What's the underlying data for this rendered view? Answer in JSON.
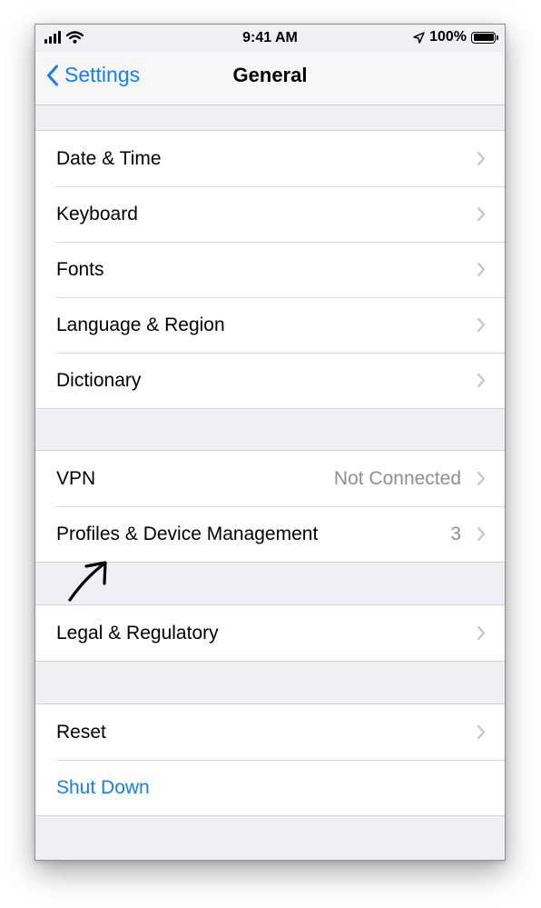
{
  "status": {
    "time": "9:41 AM",
    "battery": "100%"
  },
  "nav": {
    "back_label": "Settings",
    "title": "General"
  },
  "groups": [
    {
      "items": [
        {
          "label": "Date & Time"
        },
        {
          "label": "Keyboard"
        },
        {
          "label": "Fonts"
        },
        {
          "label": "Language & Region"
        },
        {
          "label": "Dictionary"
        }
      ]
    },
    {
      "items": [
        {
          "label": "VPN",
          "detail": "Not Connected"
        },
        {
          "label": "Profiles & Device Management",
          "detail": "3"
        }
      ]
    },
    {
      "items": [
        {
          "label": "Legal & Regulatory"
        }
      ]
    },
    {
      "items": [
        {
          "label": "Reset"
        },
        {
          "label": "Shut Down"
        }
      ]
    }
  ],
  "colors": {
    "accent": "#147efb",
    "background": "#efeff4",
    "annotation": "#000000"
  },
  "icons": [
    "cellular-signal-icon",
    "wifi-icon",
    "location-arrow-icon",
    "battery-icon",
    "chevron-left-icon",
    "chevron-right-icon",
    "annotation-arrow-icon"
  ]
}
